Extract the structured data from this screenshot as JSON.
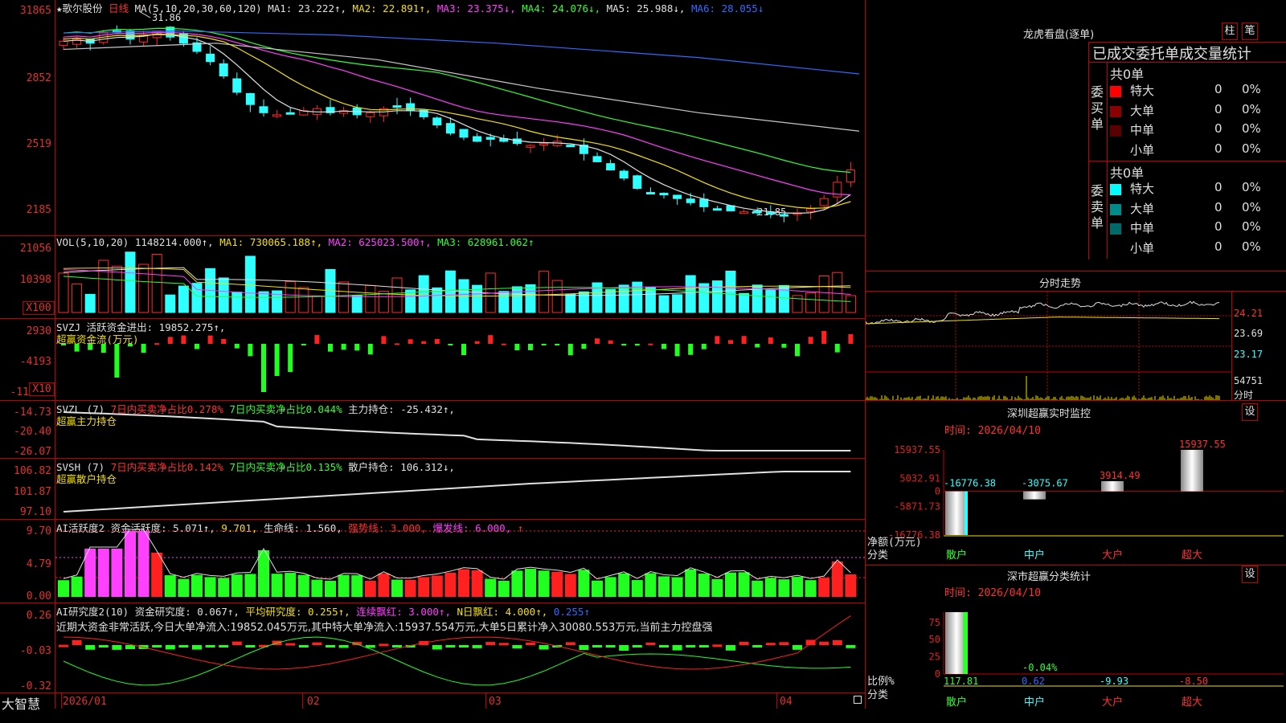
{
  "stock": {
    "title": "★歌尔股份",
    "period": "日线",
    "ma_header": [
      {
        "text": "MA(5,10,20,30,60,120)",
        "color": "#e0e0e0"
      },
      {
        "text": "MA1: 23.222↑,",
        "color": "#e0e0e0"
      },
      {
        "text": "MA2: 22.891↑,",
        "color": "#f4e000"
      },
      {
        "text": "MA3: 23.375↓,",
        "color": "#ff40ff"
      },
      {
        "text": "MA4: 24.076↓,",
        "color": "#30ff30"
      },
      {
        "text": "MA5: 25.988↓,",
        "color": "#e0e0e0"
      },
      {
        "text": "MA6: 28.055↓",
        "color": "#2f6bff"
      }
    ],
    "price_axis": [
      "31865",
      "2852",
      "2519",
      "2185"
    ],
    "high_marker": "31.86",
    "low_marker": "←21.85"
  },
  "vol": {
    "header": [
      {
        "text": "VOL(5,10,20) 1148214.000↑,",
        "color": "#e0e0e0"
      },
      {
        "text": "MA1: 730065.188↑,",
        "color": "#f4e000"
      },
      {
        "text": "MA2: 625023.500↑,",
        "color": "#ff40ff"
      },
      {
        "text": "MA3: 628961.062↑",
        "color": "#30ff30"
      }
    ],
    "axis": [
      "21056",
      "10398",
      "X100"
    ]
  },
  "svzj": {
    "header": [
      {
        "text": "SVZJ  活跃资金进出: 19852.275↑,",
        "color": "#e0e0e0"
      }
    ],
    "sub": "超赢资金流(万元)",
    "axis": [
      "2930",
      "-4193",
      "-11",
      "X10"
    ]
  },
  "svzl": {
    "header": [
      {
        "text": "SVZL (7)",
        "color": "#e0e0e0"
      },
      {
        "text": "7日内买卖净占比0.278%",
        "color": "#ff3030"
      },
      {
        "text": "7日内买卖净占比0.044%",
        "color": "#30ff30"
      },
      {
        "text": "主力持仓: -25.432↑,",
        "color": "#e0e0e0"
      }
    ],
    "sub": "超赢主力持仓",
    "axis": [
      "-14.73",
      "-20.40",
      "-26.07"
    ]
  },
  "svsh": {
    "header": [
      {
        "text": "SVSH (7)",
        "color": "#e0e0e0"
      },
      {
        "text": "7日内买卖净占比0.142%",
        "color": "#ff3030"
      },
      {
        "text": "7日内买卖净占比0.135%",
        "color": "#30ff30"
      },
      {
        "text": "散户持仓: 106.312↓,",
        "color": "#e0e0e0"
      }
    ],
    "sub": "超赢散户持仓",
    "axis": [
      "106.82",
      "101.87",
      "97.10"
    ]
  },
  "ai_active": {
    "header": [
      {
        "text": "AI活跃度2 资金活跃度: 5.071↑,",
        "color": "#e0e0e0"
      },
      {
        "text": "9.701,",
        "color": "#f4e000"
      },
      {
        "text": "生命线: 1.560,",
        "color": "#e0e0e0"
      },
      {
        "text": "强势线: 3.000,",
        "color": "#ff3030"
      },
      {
        "text": "爆发线: 6.000,",
        "color": "#ff40ff"
      },
      {
        "text": "↑",
        "color": "#ff3030"
      }
    ],
    "axis": [
      "9.70",
      "4.79",
      "0.00"
    ]
  },
  "ai_research": {
    "header": [
      {
        "text": "AI研究度2(10) 资金研究度: 0.067↑,",
        "color": "#e0e0e0"
      },
      {
        "text": "平均研究度: 0.255↑,",
        "color": "#f4e000"
      },
      {
        "text": "连续飘红: 3.000↑,",
        "color": "#ff40ff"
      },
      {
        "text": "N日飘红: 4.000↑,",
        "color": "#f4e000"
      },
      {
        "text": "0.255↑",
        "color": "#2f6bff"
      }
    ],
    "summary": "近期大资金非常活跃,今日大单净流入:19852.045万元,其中特大单净流入:15937.554万元,大单5日累计净入30080.553万元,当前主力控盘强",
    "axis": [
      "0.26",
      "-0.03",
      "-0.32"
    ]
  },
  "bottom": {
    "brand": "大智慧",
    "dates": [
      "2026/01",
      "02",
      "03",
      "04"
    ]
  },
  "right": {
    "dragon_title": "龙虎看盘(逐单)",
    "btn_bar": "柱",
    "btn_stroke": "笔",
    "stats_title": "已成交委托单成交量统计",
    "buy": {
      "side": "委买单",
      "total": "共0单",
      "rows": [
        {
          "label": "特大",
          "count": "0",
          "pct": "0%",
          "color": "#ff0000"
        },
        {
          "label": "大单",
          "count": "0",
          "pct": "0%",
          "color": "#8b0000"
        },
        {
          "label": "中单",
          "count": "0",
          "pct": "0%",
          "color": "#5a0000"
        },
        {
          "label": "小单",
          "count": "0",
          "pct": "0%",
          "color": "#000000"
        }
      ]
    },
    "sell": {
      "side": "委卖单",
      "total": "共0单",
      "rows": [
        {
          "label": "特大",
          "count": "0",
          "pct": "0%",
          "color": "#00ffff"
        },
        {
          "label": "大单",
          "count": "0",
          "pct": "0%",
          "color": "#008b8b"
        },
        {
          "label": "中单",
          "count": "0",
          "pct": "0%",
          "color": "#006a6a"
        },
        {
          "label": "小单",
          "count": "0",
          "pct": "0%",
          "color": "#000000"
        }
      ]
    },
    "intraday": {
      "title": "分时走势",
      "axis": [
        "24.21",
        "23.69",
        "23.17",
        "54751"
      ],
      "unit": "分时"
    },
    "sz_monitor": {
      "title": "深圳超赢实时监控",
      "settings": "设",
      "time": "时间: 2026/04/10",
      "axis": [
        "15937.55",
        "5032.91",
        "0",
        "-5871.73",
        "-16776.38"
      ],
      "ylabel": "净额(万元)",
      "xlabel": "分类",
      "categories": [
        "散户",
        "中户",
        "大户",
        "超大"
      ],
      "values": [
        -16776.38,
        -3075.67,
        3914.49,
        15937.55
      ],
      "value_labels": [
        "-16776.38",
        "-3075.67",
        "3914.49",
        "15937.55"
      ]
    },
    "sz_class": {
      "title": "深市超赢分类统计",
      "settings": "设",
      "time": "时间: 2026/04/10",
      "axis": [
        "75",
        "50",
        "25",
        "0"
      ],
      "ylabel": "比例%",
      "xlabel": "分类",
      "categories": [
        "散户",
        "中户",
        "大户",
        "超大"
      ],
      "values": [
        117.81,
        0.62,
        -9.93,
        -8.5
      ],
      "value_labels": [
        "117.81",
        "0.62",
        "-9.93",
        "-8.50"
      ],
      "extra_label": "-0.04%"
    }
  },
  "chart_data": [
    {
      "type": "bar",
      "title": "深圳超赢实时监控",
      "ylabel": "净额(万元)",
      "xlabel": "分类",
      "categories": [
        "散户",
        "中户",
        "大户",
        "超大"
      ],
      "values": [
        -16776.38,
        -3075.67,
        3914.49,
        15937.55
      ],
      "ylim": [
        -16776.38,
        15937.55
      ]
    },
    {
      "type": "bar",
      "title": "深市超赢分类统计",
      "ylabel": "比例%",
      "xlabel": "分类",
      "categories": [
        "散户",
        "中户",
        "大户",
        "超大"
      ],
      "values": [
        117.81,
        0.62,
        -9.93,
        -8.5
      ],
      "ylim": [
        0,
        75
      ]
    }
  ]
}
